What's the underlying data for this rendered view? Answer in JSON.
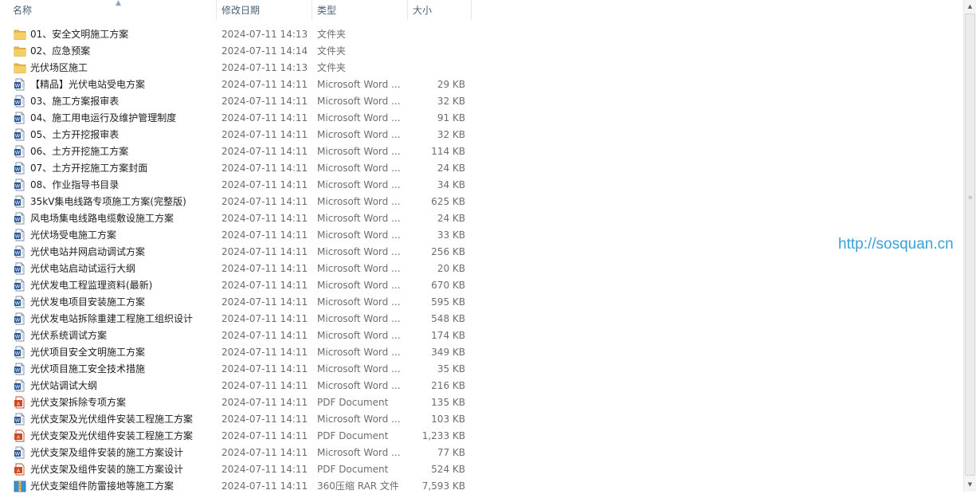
{
  "columns": {
    "name": "名称",
    "date": "修改日期",
    "type": "类型",
    "size": "大小"
  },
  "colors": {
    "header_text": "#4c607a",
    "folder": "#e8b84a",
    "word": "#2b5797",
    "pdf": "#d04a1f",
    "rar": "#3a8fd6",
    "watermark": "#38a1d8"
  },
  "files": [
    {
      "name": "01、安全文明施工方案",
      "date": "2024-07-11 14:13",
      "type": "文件夹",
      "size": "",
      "icon": "folder-icon"
    },
    {
      "name": "02、应急预案",
      "date": "2024-07-11 14:14",
      "type": "文件夹",
      "size": "",
      "icon": "folder-icon"
    },
    {
      "name": "光伏场区施工",
      "date": "2024-07-11 14:13",
      "type": "文件夹",
      "size": "",
      "icon": "folder-icon"
    },
    {
      "name": "【精品】光伏电站受电方案",
      "date": "2024-07-11 14:11",
      "type": "Microsoft Word ...",
      "size": "29 KB",
      "icon": "word-doc-icon"
    },
    {
      "name": "03、施工方案报审表",
      "date": "2024-07-11 14:11",
      "type": "Microsoft Word ...",
      "size": "32 KB",
      "icon": "word-doc-icon"
    },
    {
      "name": "04、施工用电运行及维护管理制度",
      "date": "2024-07-11 14:11",
      "type": "Microsoft Word ...",
      "size": "91 KB",
      "icon": "word-doc-icon"
    },
    {
      "name": "05、土方开挖报审表",
      "date": "2024-07-11 14:11",
      "type": "Microsoft Word ...",
      "size": "32 KB",
      "icon": "word-doc-icon"
    },
    {
      "name": "06、土方开挖施工方案",
      "date": "2024-07-11 14:11",
      "type": "Microsoft Word ...",
      "size": "114 KB",
      "icon": "word-doc-icon"
    },
    {
      "name": "07、土方开挖施工方案封面",
      "date": "2024-07-11 14:11",
      "type": "Microsoft Word ...",
      "size": "24 KB",
      "icon": "word-doc-icon"
    },
    {
      "name": "08、作业指导书目录",
      "date": "2024-07-11 14:11",
      "type": "Microsoft Word ...",
      "size": "34 KB",
      "icon": "word-doc-icon"
    },
    {
      "name": "35kV集电线路专项施工方案(完整版)",
      "date": "2024-07-11 14:11",
      "type": "Microsoft Word ...",
      "size": "625 KB",
      "icon": "word-doc-icon"
    },
    {
      "name": "风电场集电线路电缆敷设施工方案",
      "date": "2024-07-11 14:11",
      "type": "Microsoft Word ...",
      "size": "24 KB",
      "icon": "word-doc-icon"
    },
    {
      "name": "光伏场受电施工方案",
      "date": "2024-07-11 14:11",
      "type": "Microsoft Word ...",
      "size": "33 KB",
      "icon": "word-doc-icon"
    },
    {
      "name": "光伏电站并网启动调试方案",
      "date": "2024-07-11 14:11",
      "type": "Microsoft Word ...",
      "size": "256 KB",
      "icon": "word-doc-icon"
    },
    {
      "name": "光伏电站启动试运行大纲",
      "date": "2024-07-11 14:11",
      "type": "Microsoft Word ...",
      "size": "20 KB",
      "icon": "word-doc-icon"
    },
    {
      "name": "光伏发电工程监理资料(最新)",
      "date": "2024-07-11 14:11",
      "type": "Microsoft Word ...",
      "size": "670 KB",
      "icon": "word-doc-icon"
    },
    {
      "name": "光伏发电项目安装施工方案",
      "date": "2024-07-11 14:11",
      "type": "Microsoft Word ...",
      "size": "595 KB",
      "icon": "word-doc-icon"
    },
    {
      "name": "光伏发电站拆除重建工程施工组织设计",
      "date": "2024-07-11 14:11",
      "type": "Microsoft Word ...",
      "size": "548 KB",
      "icon": "word-doc-icon"
    },
    {
      "name": "光伏系统调试方案",
      "date": "2024-07-11 14:11",
      "type": "Microsoft Word ...",
      "size": "174 KB",
      "icon": "word-doc-icon"
    },
    {
      "name": "光伏项目安全文明施工方案",
      "date": "2024-07-11 14:11",
      "type": "Microsoft Word ...",
      "size": "349 KB",
      "icon": "word-doc-icon"
    },
    {
      "name": "光伏项目施工安全技术措施",
      "date": "2024-07-11 14:11",
      "type": "Microsoft Word ...",
      "size": "35 KB",
      "icon": "word-doc-icon"
    },
    {
      "name": "光伏站调试大纲",
      "date": "2024-07-11 14:11",
      "type": "Microsoft Word ...",
      "size": "216 KB",
      "icon": "word-doc-icon"
    },
    {
      "name": "光伏支架拆除专项方案",
      "date": "2024-07-11 14:11",
      "type": "PDF Document",
      "size": "135 KB",
      "icon": "pdf-icon"
    },
    {
      "name": "光伏支架及光伏组件安装工程施工方案",
      "date": "2024-07-11 14:11",
      "type": "Microsoft Word ...",
      "size": "103 KB",
      "icon": "word-doc-icon"
    },
    {
      "name": "光伏支架及光伏组件安装工程施工方案",
      "date": "2024-07-11 14:11",
      "type": "PDF Document",
      "size": "1,233 KB",
      "icon": "pdf-icon"
    },
    {
      "name": "光伏支架及组件安装的施工方案设计",
      "date": "2024-07-11 14:11",
      "type": "Microsoft Word ...",
      "size": "77 KB",
      "icon": "word-doc-icon"
    },
    {
      "name": "光伏支架及组件安装的施工方案设计",
      "date": "2024-07-11 14:11",
      "type": "PDF Document",
      "size": "524 KB",
      "icon": "pdf-icon"
    },
    {
      "name": "光伏支架组件防雷接地等施工方案",
      "date": "2024-07-11 14:11",
      "type": "360压缩 RAR 文件",
      "size": "7,593 KB",
      "icon": "rar-archive-icon"
    }
  ],
  "watermark": "http://sosquan.cn"
}
